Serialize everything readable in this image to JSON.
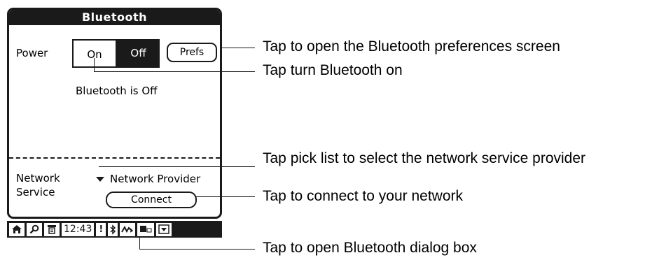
{
  "screen": {
    "title": "Bluetooth",
    "power_label": "Power",
    "on_label": "On",
    "off_label": "Off",
    "prefs_label": "Prefs",
    "status_text": "Bluetooth is Off",
    "network_label_line1": "Network",
    "network_label_line2": "Service",
    "network_provider": "Network Provider",
    "connect_label": "Connect"
  },
  "statusbar": {
    "time": "12:43",
    "icons": [
      "home-icon",
      "find-icon",
      "menu-icon",
      "alert-icon",
      "bluetooth-icon",
      "graffiti-icon",
      "keyboard-icon",
      "input-area-icon"
    ],
    "alert_glyph": "!"
  },
  "callouts": {
    "prefs": "Tap to open the Bluetooth preferences screen",
    "on": "Tap turn Bluetooth on",
    "picklist": "Tap pick list to select the network service provider",
    "connect": "Tap to connect to your network",
    "dialog": "Tap to open Bluetooth dialog box"
  }
}
